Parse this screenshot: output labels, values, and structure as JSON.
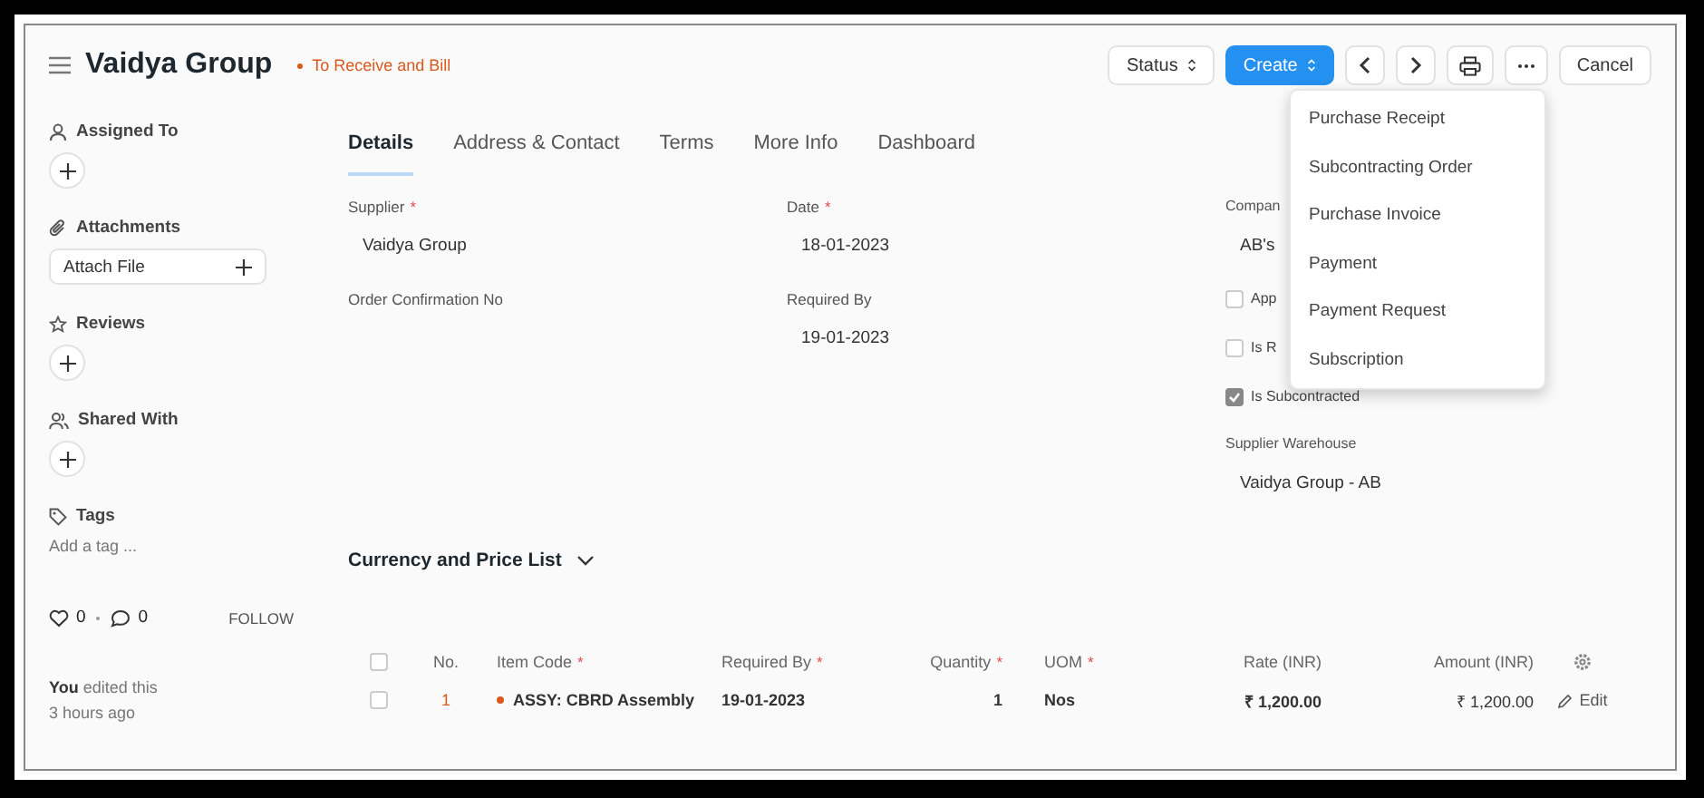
{
  "header": {
    "title": "Vaidya Group",
    "status": "To Receive and Bill",
    "actions": [
      {
        "kind": "select",
        "label": "Status"
      },
      {
        "kind": "primary",
        "label": "Create"
      },
      {
        "kind": "prev"
      },
      {
        "kind": "next"
      },
      {
        "kind": "print"
      },
      {
        "kind": "more"
      },
      {
        "kind": "plain",
        "label": "Cancel"
      }
    ]
  },
  "create_menu": [
    "Purchase Receipt",
    "Subcontracting Order",
    "Purchase Invoice",
    "Payment",
    "Payment Request",
    "Subscription"
  ],
  "sidebar": [
    {
      "kind": "assign",
      "title": "Assigned To"
    },
    {
      "kind": "attach",
      "title": "Attachments",
      "button": "Attach File"
    },
    {
      "kind": "review",
      "title": "Reviews"
    },
    {
      "kind": "share",
      "title": "Shared With"
    },
    {
      "kind": "tags",
      "title": "Tags",
      "placeholder": "Add a tag ..."
    }
  ],
  "tabs": [
    {
      "label": "Details",
      "selected": true
    },
    {
      "label": "Address & Contact",
      "selected": false
    },
    {
      "label": "Terms",
      "selected": false
    },
    {
      "label": "More Info",
      "selected": false
    },
    {
      "label": "Dashboard",
      "selected": false
    }
  ],
  "fields": [
    [
      {
        "kind": "field",
        "label": "Supplier",
        "mark": "*",
        "value": "Vaidya Group"
      },
      {
        "kind": "field",
        "label": "Order Confirmation No"
      }
    ],
    [
      {
        "kind": "field",
        "label": "Date",
        "mark": "*",
        "value": "18-01-2023"
      },
      {
        "kind": "field",
        "label": "Required By",
        "value": "19-01-2023"
      }
    ],
    [
      {
        "kind": "field",
        "label": "Compan",
        "value": "AB's"
      },
      {
        "kind": "check",
        "label": "App",
        "checked": false
      },
      {
        "kind": "check",
        "label": "Is R",
        "checked": false
      },
      {
        "kind": "check",
        "label": "Is Subcontracted",
        "checked": true
      },
      {
        "kind": "field",
        "label": "Supplier Warehouse",
        "value": "Vaidya Group - AB"
      }
    ]
  ],
  "section": {
    "title": "Currency and Price List",
    "expanded": false
  },
  "table": {
    "all_checked": false,
    "columns": [
      {
        "label": "No."
      },
      {
        "label": "Item Code",
        "mark": "*"
      },
      {
        "label": "Required By",
        "mark": "*"
      },
      {
        "label": "Quantity",
        "mark": "*"
      },
      {
        "label": "UOM",
        "mark": "*"
      },
      {
        "label": "Rate (INR)"
      },
      {
        "label": "Amount (INR)"
      }
    ],
    "rows": [
      {
        "checked": false,
        "color": "#d9581c",
        "cells": [
          "1",
          "ASSY: CBRD Assembly",
          "19-01-2023",
          "1",
          "Nos",
          "₹ 1,200.00",
          "₹ 1,200.00"
        ],
        "action": "Edit"
      }
    ]
  },
  "footer": {
    "likes": "0",
    "comments": "0",
    "follow": "FOLLOW",
    "activity": "**You** edited this",
    "time": "3 hours ago"
  }
}
